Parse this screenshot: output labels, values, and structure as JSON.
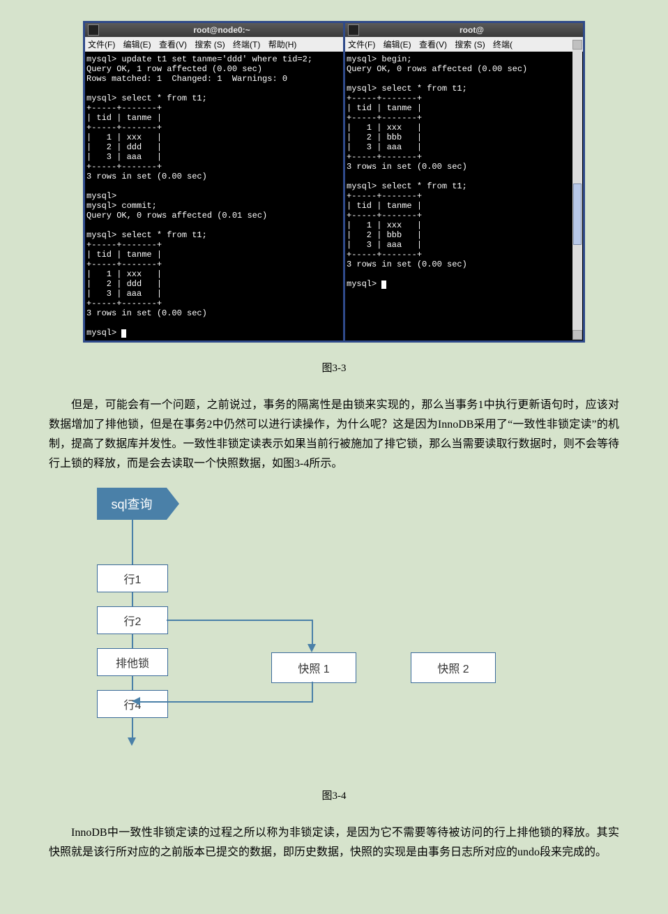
{
  "terminal_left": {
    "title": "root@node0:~",
    "menu": [
      "文件(F)",
      "编辑(E)",
      "查看(V)",
      "搜索 (S)",
      "终端(T)",
      "帮助(H)"
    ],
    "body": "mysql> update t1 set tanme='ddd' where tid=2;\nQuery OK, 1 row affected (0.00 sec)\nRows matched: 1  Changed: 1  Warnings: 0\n\nmysql> select * from t1;\n+-----+-------+\n| tid | tanme |\n+-----+-------+\n|   1 | xxx   |\n|   2 | ddd   |\n|   3 | aaa   |\n+-----+-------+\n3 rows in set (0.00 sec)\n\nmysql>\nmysql> commit;\nQuery OK, 0 rows affected (0.01 sec)\n\nmysql> select * from t1;\n+-----+-------+\n| tid | tanme |\n+-----+-------+\n|   1 | xxx   |\n|   2 | ddd   |\n|   3 | aaa   |\n+-----+-------+\n3 rows in set (0.00 sec)\n\nmysql> "
  },
  "terminal_right": {
    "title": "root@",
    "menu": [
      "文件(F)",
      "编辑(E)",
      "查看(V)",
      "搜索 (S)",
      "终端("
    ],
    "body": "mysql> begin;\nQuery OK, 0 rows affected (0.00 sec)\n\nmysql> select * from t1;\n+-----+-------+\n| tid | tanme |\n+-----+-------+\n|   1 | xxx   |\n|   2 | bbb   |\n|   3 | aaa   |\n+-----+-------+\n3 rows in set (0.00 sec)\n\nmysql> select * from t1;\n+-----+-------+\n| tid | tanme |\n+-----+-------+\n|   1 | xxx   |\n|   2 | bbb   |\n|   3 | aaa   |\n+-----+-------+\n3 rows in set (0.00 sec)\n\nmysql> "
  },
  "caption1": "图3-3",
  "para1": "但是，可能会有一个问题，之前说过，事务的隔离性是由锁来实现的，那么当事务1中执行更新语句时，应该对数据增加了排他锁，但是在事务2中仍然可以进行读操作，为什么呢？这是因为InnoDB采用了“一致性非锁定读”的机制，提高了数据库并发性。一致性非锁定读表示如果当前行被施加了排它锁，那么当需要读取行数据时，则不会等待行上锁的释放，而是会去读取一个快照数据，如图3-4所示。",
  "diagram": {
    "flag": "sql查询",
    "row1": "行1",
    "row2": "行2",
    "lock": "排他锁",
    "row4": "行4",
    "snap1": "快照 1",
    "snap2": "快照 2"
  },
  "caption2": "图3-4",
  "para2": "InnoDB中一致性非锁定读的过程之所以称为非锁定读，是因为它不需要等待被访问的行上排他锁的释放。其实快照就是该行所对应的之前版本已提交的数据，即历史数据，快照的实现是由事务日志所对应的undo段来完成的。"
}
